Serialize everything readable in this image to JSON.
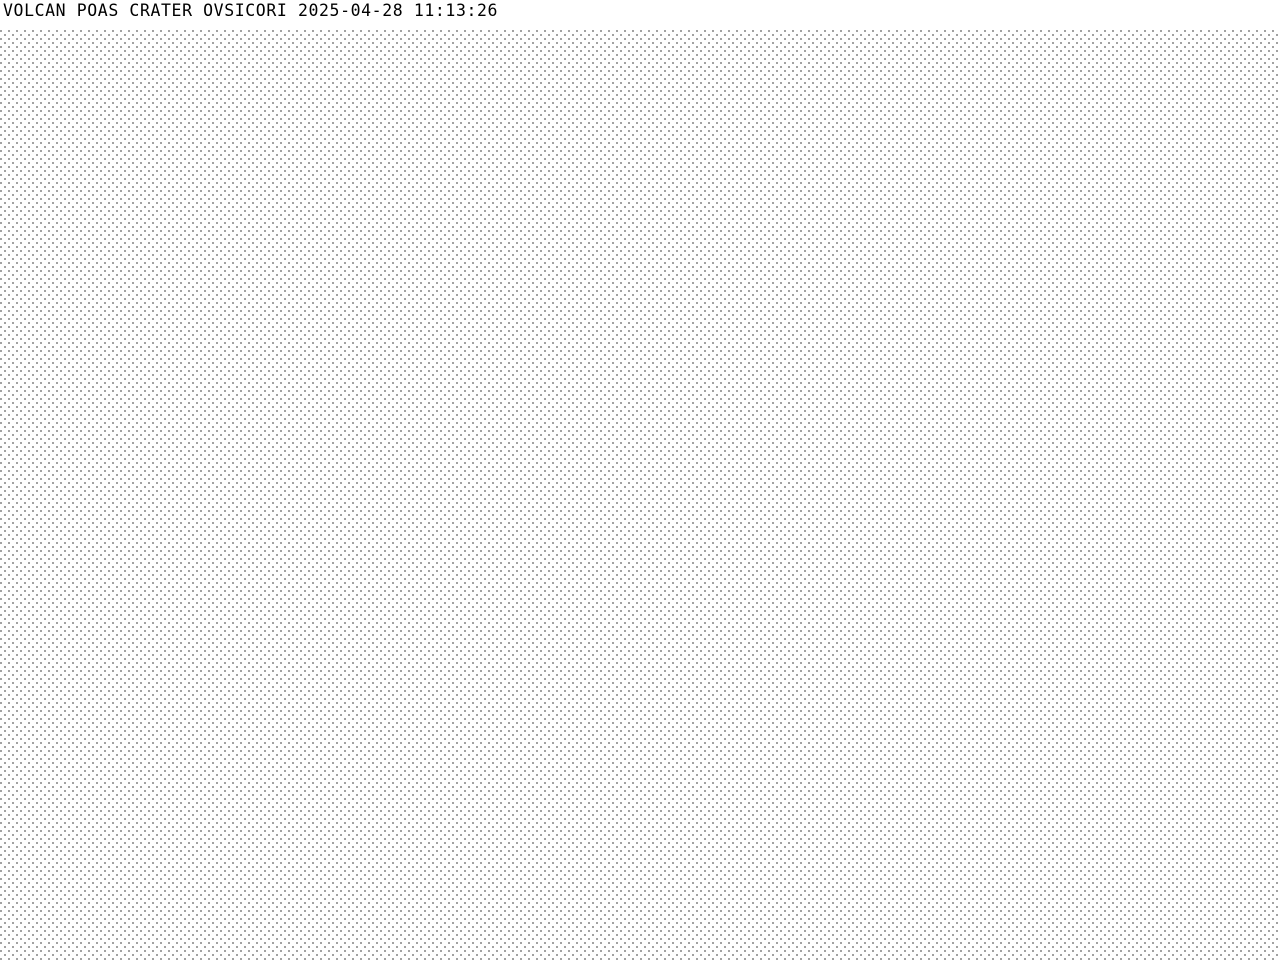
{
  "overlay": {
    "caption": "VOLCAN POAS CRATER OVSICORI 2025-04-28 11:13:26"
  },
  "colors": {
    "background": "#ffffff",
    "text": "#000000",
    "dots": "#1a1a1a"
  }
}
